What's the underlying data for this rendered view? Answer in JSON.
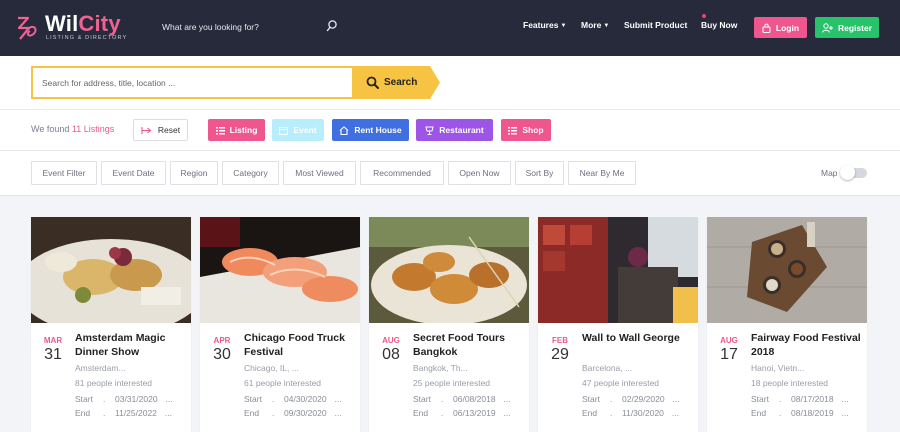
{
  "header": {
    "logo_main": "Wil",
    "logo_accent": "City",
    "logo_sub": "LISTING & DIRECTORY",
    "search_placeholder": "What are you looking for?",
    "nav": {
      "features": "Features",
      "more": "More",
      "submit": "Submit Product",
      "buy": "Buy Now"
    },
    "login": "Login",
    "register": "Register"
  },
  "search": {
    "placeholder": "Search for address, title, location ...",
    "button": "Search"
  },
  "results": {
    "prefix": "We found",
    "count": "11 Listings",
    "reset": "Reset",
    "categories": [
      {
        "label": "Listing",
        "color": "#f0568e"
      },
      {
        "label": "Event",
        "color": "#b8eefc"
      },
      {
        "label": "Rent House",
        "color": "#3f6fe0"
      },
      {
        "label": "Restaurant",
        "color": "#9d55e8"
      },
      {
        "label": "Shop",
        "color": "#f0568e"
      }
    ]
  },
  "filters": [
    "Event Filter",
    "Event Date",
    "Region",
    "Category",
    "Most Viewed",
    "Recommended",
    "Open Now",
    "Sort By",
    "Near By Me"
  ],
  "map_label": "Map",
  "cards": [
    {
      "month": "MAR",
      "day": "31",
      "title": "Amsterdam Magic Dinner Show",
      "location": "Amsterdam...",
      "interest": "81 people interested",
      "start_label": "Start",
      "start": "03/31/2020",
      "end_label": "End",
      "end": "11/25/2022"
    },
    {
      "month": "APR",
      "day": "30",
      "title": "Chicago Food Truck Festival",
      "location": "Chicago, IL, ...",
      "interest": "61 people interested",
      "start_label": "Start",
      "start": "04/30/2020",
      "end_label": "End",
      "end": "09/30/2020"
    },
    {
      "month": "AUG",
      "day": "08",
      "title": "Secret Food Tours Bangkok",
      "location": "Bangkok, Th...",
      "interest": "25 people interested",
      "start_label": "Start",
      "start": "06/08/2018",
      "end_label": "End",
      "end": "06/13/2019"
    },
    {
      "month": "FEB",
      "day": "29",
      "title": "Wall to Wall George",
      "location": "Barcelona, ...",
      "interest": "47 people interested",
      "start_label": "Start",
      "start": "02/29/2020",
      "end_label": "End",
      "end": "11/30/2020"
    },
    {
      "month": "AUG",
      "day": "17",
      "title": "Fairway Food Festival 2018",
      "location": "Hanoi, Vietn...",
      "interest": "18 people interested",
      "start_label": "Start",
      "start": "08/17/2018",
      "end_label": "End",
      "end": "08/18/2019"
    }
  ],
  "colors": {
    "header_bg": "#262a3b",
    "accent_pink": "#f0568e",
    "register_green": "#27c26a",
    "search_yellow": "#f6c342"
  }
}
